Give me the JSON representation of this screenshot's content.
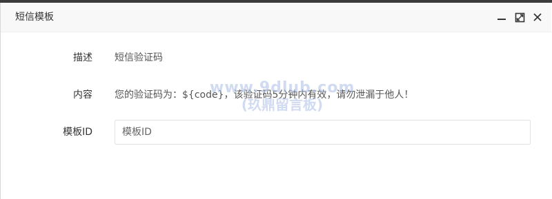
{
  "dialog": {
    "title": "短信模板",
    "controls": {
      "minimize_icon": "minimize-icon",
      "maximize_icon": "maximize-icon",
      "close_icon": "close-icon"
    }
  },
  "form": {
    "description": {
      "label": "描述",
      "value": "短信验证码"
    },
    "content": {
      "label": "内容",
      "value": "您的验证码为：${code}，该验证码5分钟内有效，请勿泄漏于他人！"
    },
    "template_id": {
      "label": "模板ID",
      "placeholder": "模板ID",
      "value": ""
    }
  },
  "watermark": {
    "line1": "www.9dlub.com",
    "line2": "(玖鼎留言板)"
  }
}
